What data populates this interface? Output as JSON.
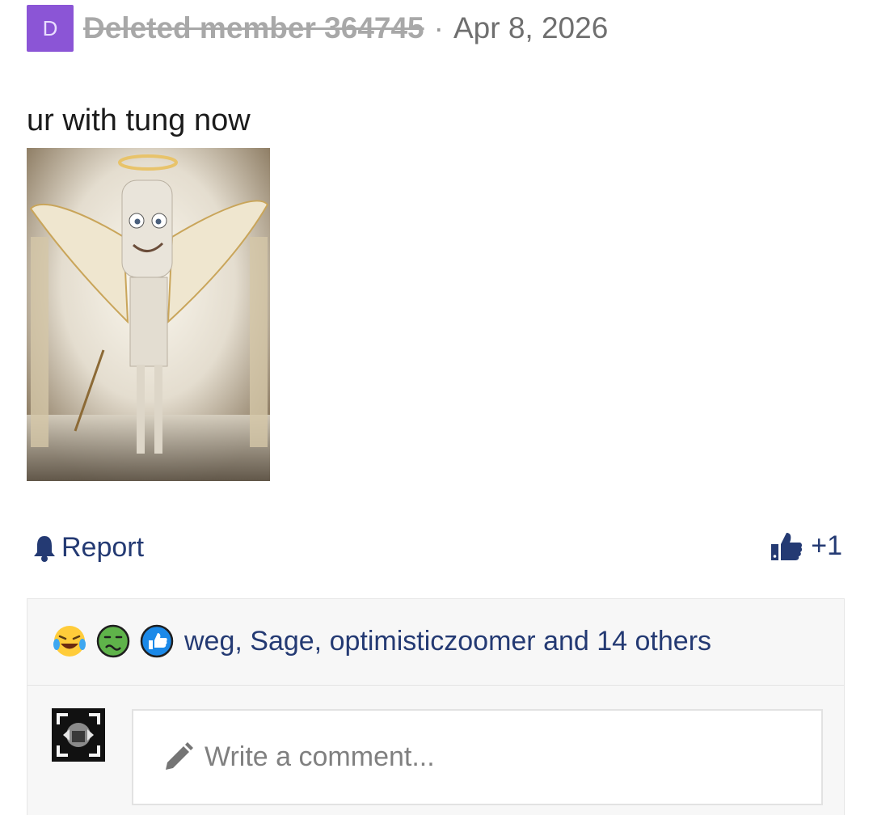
{
  "post": {
    "author_initial": "D",
    "author": "Deleted member 364745",
    "separator": "·",
    "date": "Apr 8, 2026",
    "text": "ur with tung now"
  },
  "actions": {
    "report_label": "Report",
    "like_count": "+1"
  },
  "reactions": {
    "icons": [
      "laughing-crying-emoji-icon",
      "nauseated-face-emoji-icon",
      "thumbs-up-reaction-icon"
    ],
    "summary": "weg, Sage, optimisticzoomer and 14 others"
  },
  "comment": {
    "placeholder": "Write a comment..."
  },
  "colors": {
    "link": "#243a73",
    "avatar_purple": "#8b55d6"
  }
}
